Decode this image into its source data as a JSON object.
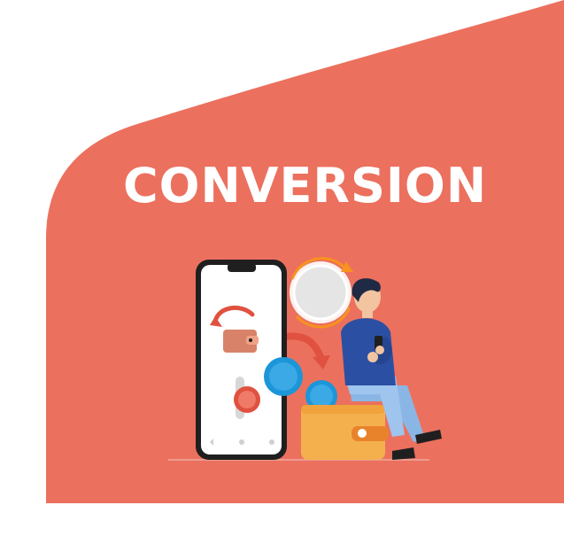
{
  "title": "CONVERSION",
  "colors": {
    "background": "#ffffff",
    "banner": "#ec705e",
    "title_text": "#ffffff",
    "phone_frame": "#1f1f1f",
    "wallet": "#f5b04e",
    "coin_blue": "#1c96d8",
    "accent_orange": "#f7931e",
    "accent_red": "#e0513f",
    "shirt": "#2b4fa3",
    "jeans": "#8ab6e6"
  },
  "icons": [
    "phone-icon",
    "wallet-icon",
    "coin-icon",
    "exchange-arrow-icon",
    "person-illustration"
  ]
}
